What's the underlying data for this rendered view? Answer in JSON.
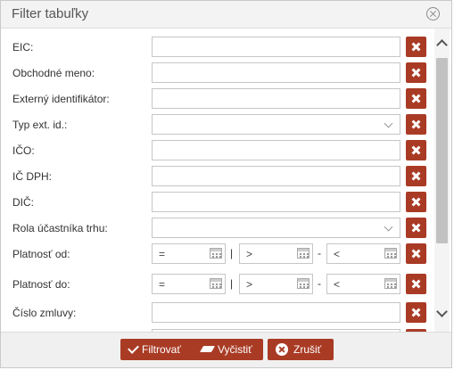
{
  "dialog": {
    "title": "Filter tabuľky"
  },
  "fields": [
    {
      "label": "EIC:",
      "type": "text",
      "value": ""
    },
    {
      "label": "Obchodné meno:",
      "type": "text",
      "value": ""
    },
    {
      "label": "Externý identifikátor:",
      "type": "text",
      "value": ""
    },
    {
      "label": "Typ ext. id.:",
      "type": "select",
      "value": ""
    },
    {
      "label": "IČO:",
      "type": "text",
      "value": ""
    },
    {
      "label": "IČ DPH:",
      "type": "text",
      "value": ""
    },
    {
      "label": "DIČ:",
      "type": "text",
      "value": ""
    },
    {
      "label": "Rola účastníka trhu:",
      "type": "select",
      "value": ""
    },
    {
      "label": "Platnosť od:",
      "type": "daterange",
      "eq": "=",
      "gt": ">",
      "lt": "<",
      "pipe": "|",
      "dash": "-"
    },
    {
      "label": "Platnosť do:",
      "type": "daterange",
      "eq": "=",
      "gt": ">",
      "lt": "<",
      "pipe": "|",
      "dash": "-"
    },
    {
      "label": "Číslo zmluvy:",
      "type": "text",
      "value": ""
    }
  ],
  "footer": {
    "filter_label": "Filtrovať",
    "clear_label": "Vyčistiť",
    "cancel_label": "Zrušiť"
  },
  "colors": {
    "accent": "#a93b25",
    "title_bg": "#f3f3f3",
    "footer_bg": "#f0f0f0"
  }
}
